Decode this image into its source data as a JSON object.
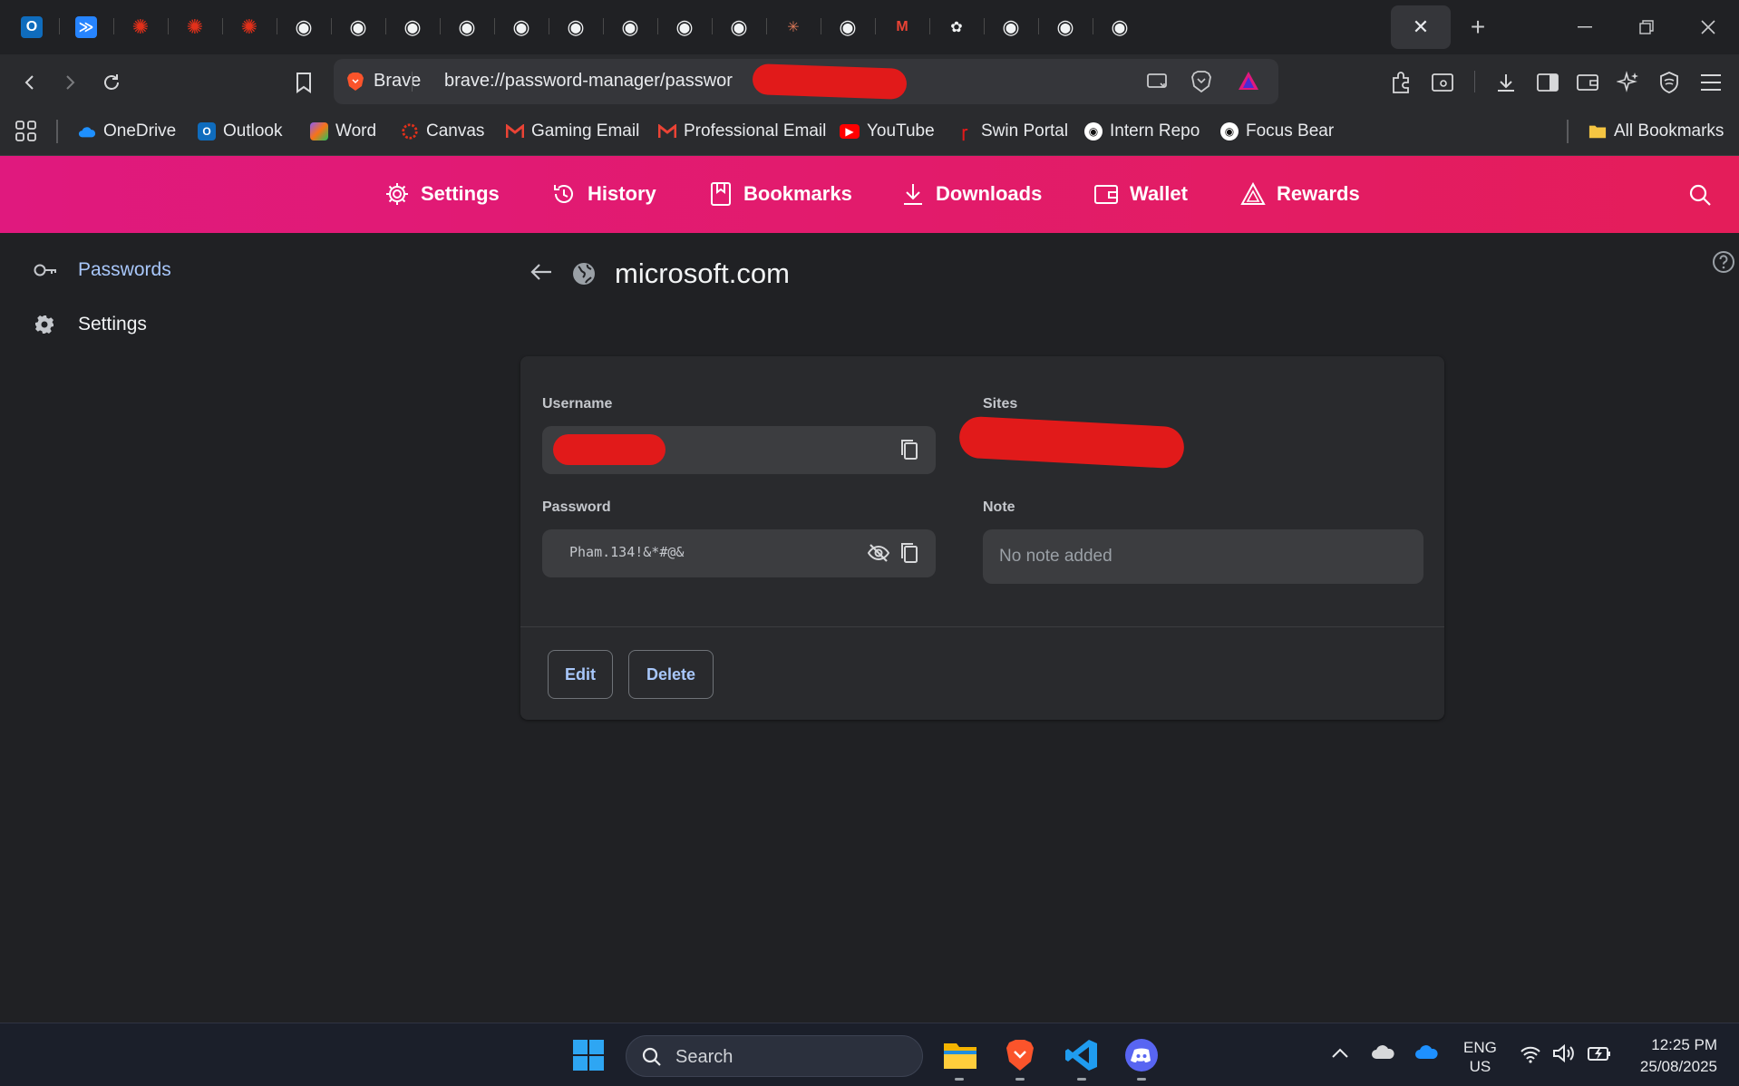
{
  "tabs": {
    "favicons": [
      "outlook-icon",
      "jira-icon",
      "canvas-icon",
      "canvas-icon",
      "canvas-icon",
      "github-icon",
      "github-icon",
      "github-icon",
      "github-icon",
      "github-icon",
      "github-icon",
      "github-icon",
      "github-icon",
      "github-icon",
      "claude-icon",
      "github-icon",
      "gmail-icon",
      "chatgpt-icon",
      "github-icon",
      "github-icon",
      "github-icon"
    ],
    "active_close": "✕",
    "new_tab": "+"
  },
  "toolbar": {
    "brand": "Brave",
    "url": "brave://password-manager/passwor"
  },
  "bookmarks": {
    "items": [
      "OneDrive",
      "Outlook",
      "Word",
      "Canvas",
      "Gaming Email",
      "Professional Email",
      "YouTube",
      "Swin Portal",
      "Intern Repo",
      "Focus Bear"
    ],
    "all_bookmarks": "All Bookmarks"
  },
  "header": {
    "nav": [
      "Settings",
      "History",
      "Bookmarks",
      "Downloads",
      "Wallet",
      "Rewards"
    ]
  },
  "sidebar": {
    "items": [
      {
        "label": "Passwords",
        "icon": "key-icon",
        "active": true
      },
      {
        "label": "Settings",
        "icon": "gear-icon",
        "active": false
      }
    ]
  },
  "main": {
    "title": "microsoft.com",
    "username_label": "Username",
    "sites_label": "Sites",
    "password_label": "Password",
    "password_value": "Pham.134!&*#@&",
    "note_label": "Note",
    "note_placeholder": "No note added",
    "edit_label": "Edit",
    "delete_label": "Delete"
  },
  "taskbar": {
    "search_placeholder": "Search",
    "lang_top": "ENG",
    "lang_bottom": "US",
    "time": "12:25 PM",
    "date": "25/08/2025"
  },
  "colors": {
    "header_gradient_start": "#e0197e",
    "header_gradient_end": "#e41d5a",
    "link_blue": "#a8c7fa",
    "redaction": "#e11a1a"
  }
}
